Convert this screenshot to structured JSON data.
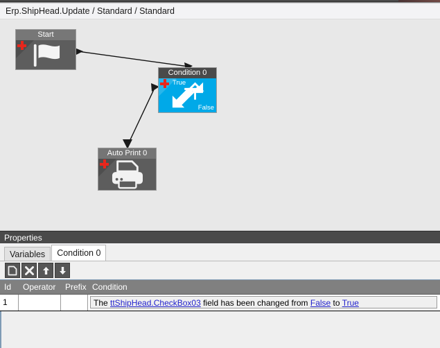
{
  "window": {
    "breadcrumb": "Erp.ShipHead.Update / Standard / Standard"
  },
  "canvas": {
    "nodes": [
      {
        "id": "start",
        "title": "Start",
        "icon": "flag-icon",
        "badge": "plus-badge"
      },
      {
        "id": "condition-0",
        "title": "Condition 0",
        "icon": "branch-arrows-icon",
        "badge": "plus-badge",
        "true_label": "True",
        "false_label": "False"
      },
      {
        "id": "auto-print-0",
        "title": "Auto Print 0",
        "icon": "printer-icon",
        "badge": "plus-badge"
      }
    ],
    "connectors": [
      {
        "from": "start",
        "to": "condition-0"
      },
      {
        "from": "condition-0",
        "to": "auto-print-0"
      }
    ],
    "colors": {
      "canvas_bg": "#e8e8e8",
      "node_header": "#4d4d4d",
      "node_body": "#5d5d5d",
      "condition_body": "#00a9e8",
      "badge": "#e8271c"
    }
  },
  "properties": {
    "header": "Properties",
    "tabs": [
      {
        "label": "Variables",
        "active": false
      },
      {
        "label": "Condition 0",
        "active": true
      }
    ],
    "toolbar": [
      {
        "name": "new-row-button",
        "icon": "page-icon",
        "glyph": ""
      },
      {
        "name": "delete-row-button",
        "icon": "close-x-icon",
        "glyph": "✖"
      },
      {
        "name": "move-up-button",
        "icon": "arrow-up-icon",
        "glyph": "↑"
      },
      {
        "name": "move-down-button",
        "icon": "arrow-down-icon",
        "glyph": "↓"
      }
    ],
    "grid": {
      "columns": [
        "Id",
        "Operator",
        "Prefix",
        "Condition"
      ],
      "rows": [
        {
          "id": "1",
          "operator": "",
          "prefix": "",
          "condition_parts": [
            {
              "text": "The ",
              "link": false
            },
            {
              "text": "ttShipHead.CheckBox03",
              "link": true
            },
            {
              "text": " field has been changed from ",
              "link": false
            },
            {
              "text": "False",
              "link": true
            },
            {
              "text": " to ",
              "link": false
            },
            {
              "text": "True",
              "link": true
            }
          ]
        }
      ]
    }
  }
}
